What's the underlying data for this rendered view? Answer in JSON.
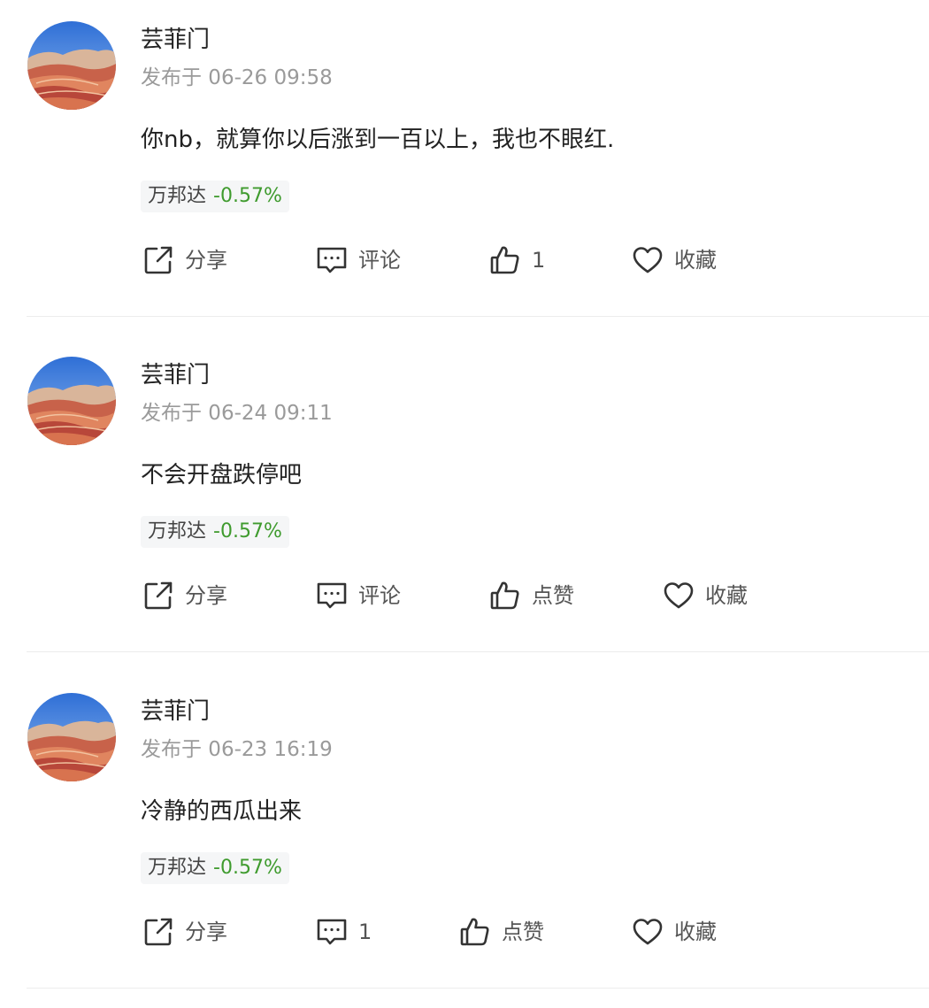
{
  "colors": {
    "negative_change": "#3f9b2e",
    "divider": "#ececec",
    "meta_text": "#9a9a9a"
  },
  "posts": [
    {
      "username": "芸菲门",
      "published": "发布于 06-26 09:58",
      "content": "你nb，就算你以后涨到一百以上，我也不眼红.",
      "stock": {
        "name": "万邦达",
        "change": "-0.57%"
      },
      "actions": {
        "share": "分享",
        "comment": "评论",
        "like": "1",
        "favorite": "收藏"
      }
    },
    {
      "username": "芸菲门",
      "published": "发布于 06-24 09:11",
      "content": "不会开盘跌停吧",
      "stock": {
        "name": "万邦达",
        "change": "-0.57%"
      },
      "actions": {
        "share": "分享",
        "comment": "评论",
        "like": "点赞",
        "favorite": "收藏"
      }
    },
    {
      "username": "芸菲门",
      "published": "发布于 06-23 16:19",
      "content": "冷静的西瓜出来",
      "stock": {
        "name": "万邦达",
        "change": "-0.57%"
      },
      "actions": {
        "share": "分享",
        "comment": "1",
        "like": "点赞",
        "favorite": "收藏"
      }
    }
  ]
}
